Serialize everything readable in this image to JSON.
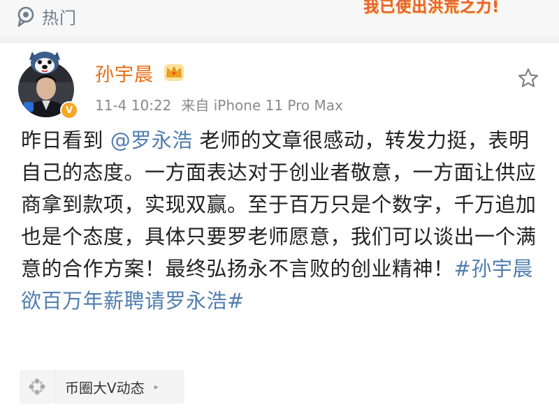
{
  "header": {
    "hot_label": "热门",
    "banner_text": "我已使出洪荒之力!"
  },
  "post": {
    "username": "孙宇晨",
    "time": "11-4 10:22",
    "source": "来自 iPhone 11 Pro Max",
    "verified_badge": "V",
    "content": {
      "text_before_mention": "昨日看到 ",
      "mention": "@罗永浩",
      "text_after_mention": " 老师的文章很感动，转发力挺，表明自己的态度。一方面表达对于创业者敬意，一方面让供应商拿到款项，实现双赢。至于百万只是个数字，千万追加也是个态度，具体只要罗老师愿意，我们可以谈出一个满意的合作方案！最终弘扬永不言败的创业精神！",
      "hashtag": "#孙宇晨欲百万年薪聘请罗永浩#"
    },
    "topic_chip": {
      "label": "币圈大V动态",
      "arrow": "▸"
    }
  },
  "colors": {
    "link": "#507daf",
    "username": "#e86b0f",
    "meta": "#8a8a8a",
    "hot": "#6f7c8c",
    "badge": "#f5a623"
  },
  "icons": [
    "location-pin-icon",
    "crown-icon",
    "star-icon",
    "verified-badge-icon",
    "topic-sparkle-icon"
  ]
}
